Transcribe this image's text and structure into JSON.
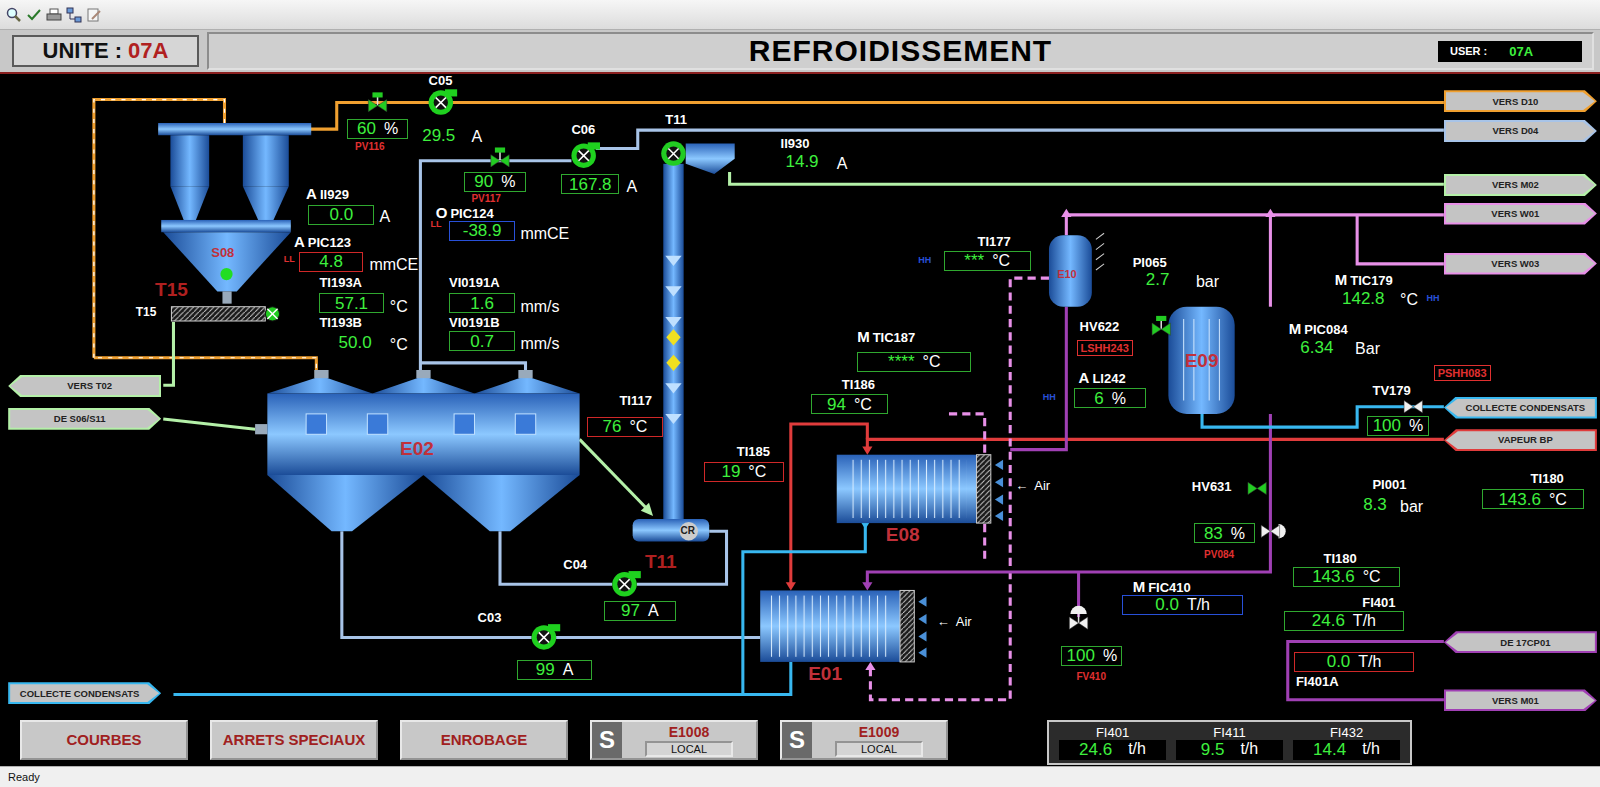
{
  "header": {
    "unit_label": "UNITE :",
    "unit": "07A",
    "title": "REFROIDISSEMENT",
    "user_label": "USER :",
    "user": "07A"
  },
  "connectors": [
    {
      "text": "VERS D10",
      "kind": "right",
      "color": "#f0a030"
    },
    {
      "text": "VERS D04",
      "kind": "right",
      "color": "#a8c4e8"
    },
    {
      "text": "VERS M02",
      "kind": "right",
      "color": "#b4f0a8"
    },
    {
      "text": "VERS W01",
      "kind": "right",
      "color": "#e890e8"
    },
    {
      "text": "VERS W03",
      "kind": "right",
      "color": "#e890e8"
    },
    {
      "text": "COLLECTE CONDENSATS",
      "kind": "left",
      "color": "#38b8f0"
    },
    {
      "text": "VAPEUR BP",
      "kind": "left",
      "color": "#e03c3c"
    },
    {
      "text": "DE 17CP01",
      "kind": "left",
      "color": "#a040b4"
    },
    {
      "text": "VERS M01",
      "kind": "right",
      "color": "#a040b4"
    },
    {
      "text": "VERS T02",
      "kind": "left",
      "color": "#b4f0a8"
    },
    {
      "text": "DE S06/S11",
      "kind": "right",
      "color": "#b4f0a8"
    },
    {
      "text": "COLLECTE CONDENSATS",
      "kind": "right",
      "color": "#38b8f0"
    }
  ],
  "equipment": [
    {
      "name": "S08",
      "color": "#c0303a"
    },
    {
      "name": "T15",
      "color": "#b02020"
    },
    {
      "name": "T15",
      "color": "#ffffff"
    },
    {
      "name": "E02",
      "color": "#c0303a"
    },
    {
      "name": "T11",
      "color": "#ffffff"
    },
    {
      "name": "T11",
      "color": "#b02020"
    },
    {
      "name": "CR",
      "color": "#202020"
    },
    {
      "name": "E08",
      "color": "#c0303a"
    },
    {
      "name": "E01",
      "color": "#c0303a"
    },
    {
      "name": "E10",
      "color": "#c0303a"
    },
    {
      "name": "E09",
      "color": "#c0303a"
    }
  ],
  "pumps": [
    {
      "name": "C05",
      "current": "29.5",
      "unit": "A",
      "running": true,
      "framed": false
    },
    {
      "name": "C06",
      "current": "167.8",
      "unit": "A",
      "running": true,
      "framed": true,
      "color": "#2fa82f"
    },
    {
      "name": "C04",
      "current": "97",
      "unit": "A",
      "running": true,
      "framed": true,
      "color": "#2fa82f"
    },
    {
      "name": "C03",
      "current": "99",
      "unit": "A",
      "running": true,
      "framed": true,
      "color": "#2fa82f"
    }
  ],
  "valves": [
    {
      "label": "",
      "active": true
    },
    {
      "label": "",
      "active": true
    },
    {
      "label": "HV622",
      "active": true
    },
    {
      "label": "HV631",
      "active": true
    },
    {
      "label": "",
      "active": false
    },
    {
      "label": "",
      "active": false
    },
    {
      "label": "",
      "active": false
    }
  ],
  "measurements": [
    {
      "tag": "PV116",
      "tag_color": "#e03030",
      "value": "60",
      "unit": "%",
      "framed": true,
      "color": "#2fa82f"
    },
    {
      "tag": "PV117",
      "tag_color": "#e03030",
      "value": "90",
      "unit": "%",
      "framed": true,
      "color": "#2fa82f"
    },
    {
      "tag": "II930",
      "tag_color": "#ffffff",
      "value": "14.9",
      "unit": "A",
      "framed": false
    },
    {
      "tag": "II929",
      "mode": "A",
      "tag_color": "#ffffff",
      "value": "0.0",
      "unit": "A",
      "framed": true,
      "color": "#2fa82f"
    },
    {
      "tag": "PIC124",
      "mode": "O",
      "alarm": "LL",
      "alarm_color": "#e03030",
      "tag_color": "#ffffff",
      "value": "-38.9",
      "unit": "mmCE",
      "framed": true,
      "color": "#2850d8"
    },
    {
      "tag": "PIC123",
      "mode": "A",
      "alarm": "LL",
      "alarm_color": "#e03030",
      "tag_color": "#ffffff",
      "value": "4.8",
      "unit": "mmCE",
      "framed": true,
      "color": "#d02828"
    },
    {
      "tag": "TI193A",
      "tag_color": "#ffffff",
      "value": "57.1",
      "unit": "°C",
      "framed": true,
      "color": "#2fa82f"
    },
    {
      "tag": "TI193B",
      "tag_color": "#ffffff",
      "value": "50.0",
      "unit": "°C",
      "framed": false
    },
    {
      "tag": "VI0191A",
      "tag_color": "#ffffff",
      "value": "1.6",
      "unit": "mm/s",
      "framed": true,
      "color": "#2fa82f"
    },
    {
      "tag": "VI0191B",
      "tag_color": "#ffffff",
      "value": "0.7",
      "unit": "mm/s",
      "framed": true,
      "color": "#2fa82f"
    },
    {
      "tag": "TI117",
      "tag_color": "#ffffff",
      "value": "76",
      "unit": "°C",
      "framed": true,
      "color": "#d02828"
    },
    {
      "tag": "TI177",
      "alarm": "HH",
      "alarm_color": "#2850d8",
      "tag_color": "#ffffff",
      "value": "***",
      "unit": "°C",
      "framed": true,
      "color": "#2fa82f"
    },
    {
      "tag": "PI065",
      "tag_color": "#ffffff",
      "value": "2.7",
      "unit": "bar",
      "framed": false
    },
    {
      "tag": "TIC179",
      "mode": "M",
      "alarm": "HH",
      "alarm_color": "#2850d8",
      "tag_color": "#ffffff",
      "value": "142.8",
      "unit": "°C",
      "framed": false
    },
    {
      "tag": "PIC084",
      "mode": "M",
      "tag_color": "#ffffff",
      "value": "6.34",
      "unit": "Bar",
      "framed": false
    },
    {
      "tag": "LI242",
      "mode": "A",
      "alarm": "HH",
      "alarm_color": "#2850d8",
      "tag_color": "#ffffff",
      "value": "6",
      "unit": "%",
      "framed": true,
      "color": "#2fa82f"
    },
    {
      "tag": "TV179",
      "tag_color": "#ffffff",
      "value": "100",
      "unit": "%",
      "framed": true,
      "color": "#2fa82f"
    },
    {
      "tag": "TIC187",
      "mode": "M",
      "tag_color": "#ffffff",
      "value": "****",
      "unit": "°C",
      "framed": true,
      "color": "#2fa82f"
    },
    {
      "tag": "TI186",
      "tag_color": "#ffffff",
      "value": "94",
      "unit": "°C",
      "framed": true,
      "color": "#2fa82f"
    },
    {
      "tag": "TI185",
      "tag_color": "#ffffff",
      "value": "19",
      "unit": "°C",
      "framed": true,
      "color": "#d02828"
    },
    {
      "tag": "PV084",
      "tag_color": "#e03030",
      "value": "83",
      "unit": "%",
      "framed": true,
      "color": "#2fa82f"
    },
    {
      "tag": "PI001",
      "tag_color": "#ffffff",
      "value": "8.3",
      "unit": "bar",
      "framed": false
    },
    {
      "tag": "TI180",
      "tag_color": "#ffffff",
      "value": "143.6",
      "unit": "°C",
      "framed": true,
      "color": "#2fa82f"
    },
    {
      "tag": "TI180",
      "tag_color": "#ffffff",
      "value": "143.6",
      "unit": "°C",
      "framed": true,
      "color": "#2fa82f"
    },
    {
      "tag": "FIC410",
      "mode": "M",
      "tag_color": "#ffffff",
      "value": "0.0",
      "unit": "T/h",
      "framed": true,
      "color": "#2850d8"
    },
    {
      "tag": "FV410",
      "tag_color": "#e03030",
      "value": "100",
      "unit": "%",
      "framed": true,
      "color": "#2fa82f"
    },
    {
      "tag": "FI401",
      "tag_color": "#ffffff",
      "value": "24.6",
      "unit": "T/h",
      "framed": true,
      "color": "#2fa82f"
    },
    {
      "tag": "FI401A",
      "tag_color": "#ffffff",
      "value": "0.0",
      "unit": "T/h",
      "framed": true,
      "color": "#d02828"
    }
  ],
  "interlocks": [
    {
      "text": "LSHH243"
    },
    {
      "text": "PSHH083"
    }
  ],
  "air_inlets": [
    {
      "arrow": "←",
      "text": "Air"
    },
    {
      "arrow": "←",
      "text": "Air"
    }
  ],
  "buttons": [
    {
      "text": "COURBES"
    },
    {
      "text": "ARRETS SPECIAUX"
    },
    {
      "text": "ENROBAGE"
    }
  ],
  "switches": [
    {
      "letter": "S",
      "name": "E1008",
      "mode": "LOCAL"
    },
    {
      "letter": "S",
      "name": "E1009",
      "mode": "LOCAL"
    }
  ],
  "summary": [
    {
      "tag": "FI401",
      "value": "24.6",
      "unit": "t/h"
    },
    {
      "tag": "FI411",
      "value": "9.5",
      "unit": "t/h"
    },
    {
      "tag": "FI432",
      "value": "14.4",
      "unit": "t/h"
    }
  ],
  "status_bar": "Ready"
}
